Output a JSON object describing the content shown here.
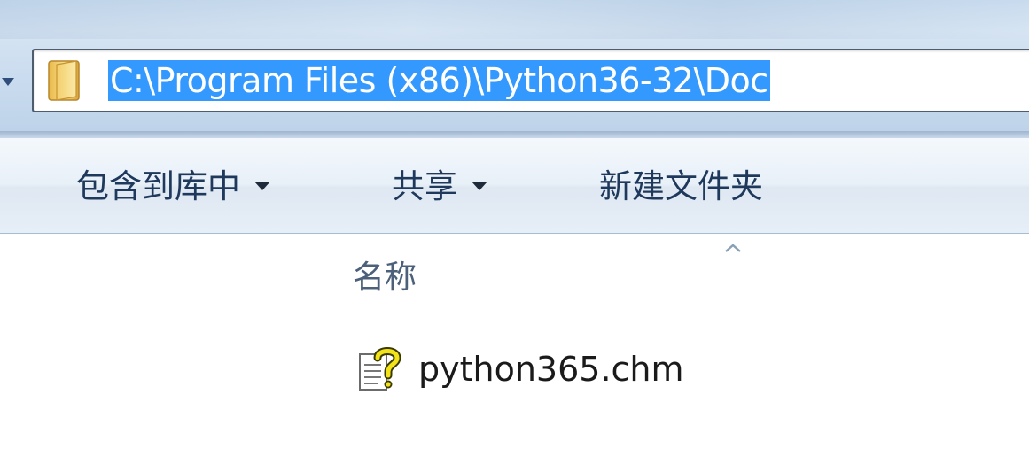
{
  "address_bar": {
    "path": "C:\\Program Files (x86)\\Python36-32\\Doc",
    "folder_icon": "folder-icon",
    "dropdown_icon": "chevron-down-icon",
    "selection_color": "#3399ff"
  },
  "toolbar": {
    "include_in_library_label": "包含到库中",
    "share_label": "共享",
    "new_folder_label": "新建文件夹",
    "text_color": "#1e395b"
  },
  "file_list": {
    "column_header": "名称",
    "sort_indicator_icon": "sort-ascending-icon",
    "items": [
      {
        "name": "python365.chm",
        "icon": "chm-help-file-icon"
      }
    ]
  }
}
